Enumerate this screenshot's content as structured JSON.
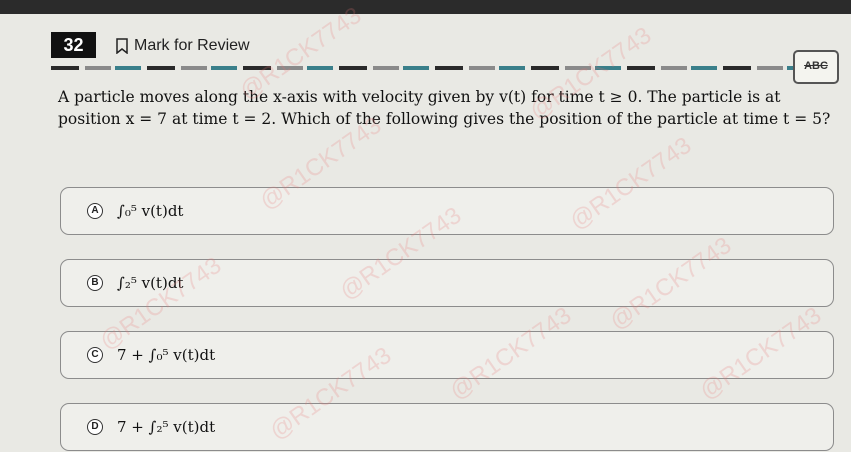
{
  "header": {
    "question_number": "32",
    "mark_label": "Mark for Review",
    "abc_label": "ABC"
  },
  "question": {
    "text": "A particle moves along the x-axis with velocity given by v(t) for time t ≥ 0. The particle is at position x = 7 at time t = 2. Which of the following gives the position of the particle at time t = 5?"
  },
  "choices": [
    {
      "letter": "A",
      "text": "∫₀⁵ v(t)dt"
    },
    {
      "letter": "B",
      "text": "∫₂⁵ v(t)dt"
    },
    {
      "letter": "C",
      "text": "7 + ∫₀⁵ v(t)dt"
    },
    {
      "letter": "D",
      "text": "7 + ∫₂⁵ v(t)dt"
    }
  ],
  "watermark": {
    "text": "@R1CK7743"
  }
}
